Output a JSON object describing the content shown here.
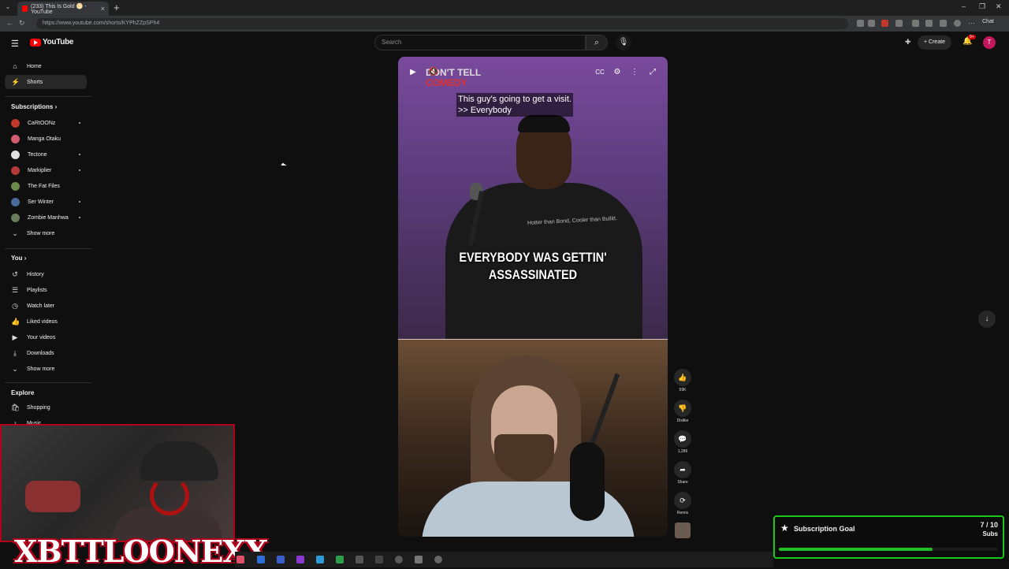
{
  "browser": {
    "tab_title": "(233) This Is Gold 🌕 - YouTube",
    "tab_close": "×",
    "new_tab": "+",
    "url": "https://www.youtube.com/shorts/KYPhZZpSPh4",
    "chat_label": "Chat"
  },
  "header": {
    "logo_text": "YouTube",
    "search_placeholder": "Search",
    "create_label": "Create",
    "notification_count": "9+",
    "avatar_letter": "T"
  },
  "sidebar": {
    "main": [
      {
        "label": "Home",
        "icon": "home-icon"
      },
      {
        "label": "Shorts",
        "icon": "shorts-icon",
        "active": true
      }
    ],
    "subscriptions_title": "Subscriptions",
    "subscriptions": [
      {
        "label": "CaRtOONz",
        "color": "#c0392b",
        "new": true
      },
      {
        "label": "Manga Otaku",
        "color": "#d35d6e",
        "new": false
      },
      {
        "label": "Tectone",
        "color": "#e0e0e0",
        "new": true
      },
      {
        "label": "Markiplier",
        "color": "#b33939",
        "new": true
      },
      {
        "label": "The Fat Files",
        "color": "#6a8a4a",
        "new": false
      },
      {
        "label": "Ser Winter",
        "color": "#4a6a9a",
        "new": true
      },
      {
        "label": "Zombie Manhwa",
        "color": "#6a7a5a",
        "new": true
      }
    ],
    "subs_show_more": "Show more",
    "you_title": "You",
    "you_items": [
      {
        "label": "History",
        "icon": "history-icon"
      },
      {
        "label": "Playlists",
        "icon": "playlists-icon"
      },
      {
        "label": "Watch later",
        "icon": "watch-later-icon"
      },
      {
        "label": "Liked videos",
        "icon": "liked-videos-icon"
      },
      {
        "label": "Your videos",
        "icon": "your-videos-icon"
      },
      {
        "label": "Downloads",
        "icon": "downloads-icon"
      }
    ],
    "you_show_more": "Show more",
    "explore_title": "Explore",
    "explore_items": [
      {
        "label": "Shopping",
        "icon": "shopping-icon"
      },
      {
        "label": "Music",
        "icon": "music-icon"
      }
    ]
  },
  "short": {
    "brand_line1": "DON'T TELL",
    "brand_line2": "COMEDY",
    "caption_line1": "This guy's going to get a visit.",
    "caption_line2": ">> Everybody",
    "big_caption_line1": "EVERYBODY WAS GETTIN'",
    "big_caption_line2": "ASSASSINATED",
    "shirt_text": "Hotter than Bond, Cooler than Bullitt."
  },
  "actions": [
    {
      "name": "like",
      "label": "59K",
      "icon": "thumbs-up-icon"
    },
    {
      "name": "dislike",
      "label": "Dislike",
      "icon": "thumbs-down-icon"
    },
    {
      "name": "comments",
      "label": "1,286",
      "icon": "comment-icon"
    },
    {
      "name": "share",
      "label": "Share",
      "icon": "share-icon"
    },
    {
      "name": "remix",
      "label": "Remix",
      "icon": "remix-icon"
    }
  ],
  "overlay": {
    "streamer_tag": "XBTTLOONEXX"
  },
  "goal": {
    "title": "Subscription Goal",
    "count": "7 / 10",
    "unit": "Subs",
    "progress": 0.7
  }
}
